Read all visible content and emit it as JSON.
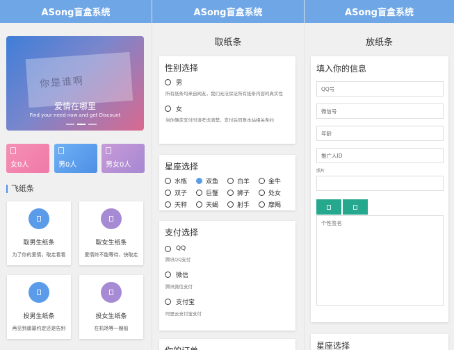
{
  "app_title": "ASong盲盒系统",
  "home": {
    "banner": {
      "scrawl": "你是谁啊",
      "title": "爱情在哪里",
      "subtitle": "Find your need now and get Discount"
    },
    "stats": [
      {
        "label": "女0人",
        "icon": "file-icon"
      },
      {
        "label": "男0人",
        "icon": "file-icon"
      },
      {
        "label": "男女0人",
        "icon": "file-icon"
      }
    ],
    "section_title": "飞纸条",
    "cards": [
      {
        "title": "取男生纸条",
        "subtitle": "为了你的爱情，取走看看",
        "color": "#5a9bea"
      },
      {
        "title": "取女生纸条",
        "subtitle": "爱情终不能等待，快取走",
        "color": "#a68bd4"
      },
      {
        "title": "投男生纸条",
        "subtitle": "再见到虞墓约定还是告别",
        "color": "#5a9bea"
      },
      {
        "title": "投女生纸条",
        "subtitle": "在机场等一艘船",
        "color": "#a68bd4"
      }
    ]
  },
  "take": {
    "title": "取纸条",
    "gender": {
      "heading": "性别选择",
      "options": [
        {
          "label": "男",
          "hint": "所有纸条均来自网友，我们无法保证所有纸条内容的真实性"
        },
        {
          "label": "女",
          "hint": "当你确定支付时请考虑清楚，支付后同意本站相关条约"
        }
      ]
    },
    "zodiac": {
      "heading": "星座选择",
      "options": [
        "水瓶",
        "双鱼",
        "白羊",
        "金牛",
        "双子",
        "巨蟹",
        "狮子",
        "处女",
        "天秤",
        "天蝎",
        "射手",
        "摩羯"
      ],
      "selected": "双鱼"
    },
    "payment": {
      "heading": "支付选择",
      "options": [
        {
          "label": "QQ",
          "hint": "腾讯QQ支付"
        },
        {
          "label": "微信",
          "hint": "腾讯微信支付"
        },
        {
          "label": "支付宝",
          "hint": "阿里云支付宝支付"
        }
      ]
    },
    "order_heading": "你的订单"
  },
  "put": {
    "title": "放纸条",
    "info_heading": "填入你的信息",
    "fields": {
      "qq": "QQ号",
      "wechat": "微信号",
      "age": "年龄",
      "promoter": "推广人ID",
      "photo_label": "照片",
      "signature": "个性签名"
    },
    "zodiac_heading": "星座选择"
  }
}
